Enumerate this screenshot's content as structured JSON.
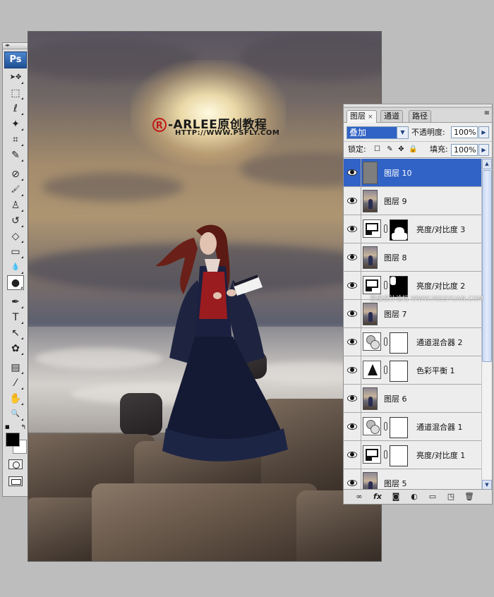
{
  "canvas": {
    "watermark_brand": "-ARLEE原创教程",
    "watermark_reg": "R",
    "watermark_url": "HTTP://WWW.PSFLY.COM"
  },
  "site_watermark": "思缘设计论坛 WWW.MISSYUAN.COM",
  "toolbox": {
    "logo": "Ps",
    "grip_label": "◂▸",
    "tools": [
      {
        "name": "move-tool",
        "glyph": "➤✥"
      },
      {
        "name": "marquee-tool",
        "glyph": "⬚"
      },
      {
        "name": "lasso-tool",
        "glyph": "ℓ"
      },
      {
        "name": "magic-wand-tool",
        "glyph": "✦"
      },
      {
        "name": "crop-tool",
        "glyph": "⌗"
      },
      {
        "name": "slice-tool",
        "glyph": "✎"
      },
      {
        "name": "healing-brush-tool",
        "glyph": "⊘"
      },
      {
        "name": "brush-tool",
        "glyph": "🖌"
      },
      {
        "name": "clone-stamp-tool",
        "glyph": "♙"
      },
      {
        "name": "history-brush-tool",
        "glyph": "↺"
      },
      {
        "name": "eraser-tool",
        "glyph": "◇"
      },
      {
        "name": "gradient-tool",
        "glyph": "▭"
      },
      {
        "name": "blur-tool",
        "glyph": "💧"
      },
      {
        "name": "dodge-tool",
        "glyph": "●"
      },
      {
        "name": "pen-tool",
        "glyph": "✒"
      },
      {
        "name": "type-tool",
        "glyph": "T"
      },
      {
        "name": "path-selection-tool",
        "glyph": "↖"
      },
      {
        "name": "custom-shape-tool",
        "glyph": "✿"
      },
      {
        "name": "notes-tool",
        "glyph": "▤"
      },
      {
        "name": "eyedropper-tool",
        "glyph": "⁄"
      },
      {
        "name": "hand-tool",
        "glyph": "✋"
      },
      {
        "name": "zoom-tool",
        "glyph": "🔍"
      }
    ],
    "active_tool_index": 13,
    "foreground_color": "#000000",
    "background_color": "#ffffff"
  },
  "layers_panel": {
    "tabs": [
      {
        "label": "图层",
        "active": true,
        "close": "×"
      },
      {
        "label": "通道",
        "active": false
      },
      {
        "label": "路径",
        "active": false
      }
    ],
    "menu_icon": "≡",
    "blend_mode": "叠加",
    "dropdown_arrow": "▼",
    "side_arrow": "▶",
    "opacity_label": "不透明度:",
    "opacity_value": "100%",
    "lock_label": "锁定:",
    "fill_label": "填充:",
    "fill_value": "100%",
    "lock_icons": [
      "☐",
      "✎",
      "✥",
      "🔒"
    ],
    "layers": [
      {
        "name": "图层 10",
        "kind": "gray",
        "selected": true
      },
      {
        "name": "图层 9",
        "kind": "photo"
      },
      {
        "name": "亮度/对比度 3",
        "kind": "bc",
        "mask": "white-figure"
      },
      {
        "name": "图层 8",
        "kind": "photo"
      },
      {
        "name": "亮度/对比度 2",
        "kind": "bc",
        "mask": "black-figure"
      },
      {
        "name": "图层 7",
        "kind": "photo"
      },
      {
        "name": "通道混合器 2",
        "kind": "cm",
        "mask": "white"
      },
      {
        "name": "色彩平衡 1",
        "kind": "cb",
        "mask": "white"
      },
      {
        "name": "图层 6",
        "kind": "photo"
      },
      {
        "name": "通道混合器 1",
        "kind": "cm",
        "mask": "white"
      },
      {
        "name": "亮度/对比度 1",
        "kind": "bc",
        "mask": "white"
      },
      {
        "name": "图层 5",
        "kind": "photo"
      }
    ],
    "scroll_up": "▲",
    "scroll_down": "▼",
    "footer_icons": [
      {
        "name": "link-layers-icon",
        "glyph": "∞"
      },
      {
        "name": "layer-style-icon",
        "glyph": "fx"
      },
      {
        "name": "add-mask-icon",
        "glyph": "◙"
      },
      {
        "name": "adjustment-layer-icon",
        "glyph": "◐"
      },
      {
        "name": "new-group-icon",
        "glyph": "▭"
      },
      {
        "name": "new-layer-icon",
        "glyph": "◳"
      },
      {
        "name": "delete-layer-icon",
        "glyph": "🗑"
      }
    ]
  }
}
